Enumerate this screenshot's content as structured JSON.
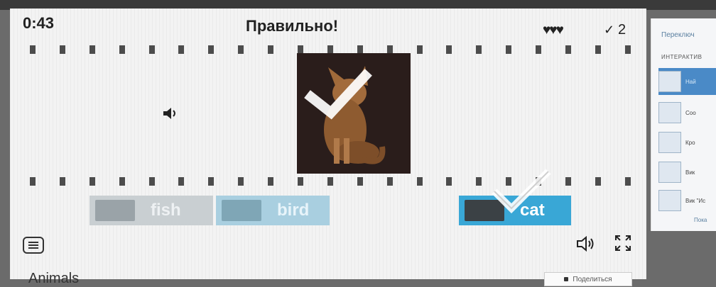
{
  "game": {
    "timer": "0:43",
    "feedback": "Правильно!",
    "lives": "♥♥♥",
    "score_check": "✓",
    "score": "2",
    "answers": [
      {
        "label": "fish",
        "state": "faded"
      },
      {
        "label": "bird",
        "state": "faded"
      },
      {
        "label": "cat",
        "state": "correct"
      }
    ],
    "title": "Animals",
    "share_label": "Поделиться"
  },
  "sidebar": {
    "title": "Переключ",
    "header": "ИНТЕРАКТИВ",
    "items": [
      {
        "label": "Най"
      },
      {
        "label": "Соо"
      },
      {
        "label": "Кро"
      },
      {
        "label": "Вик"
      },
      {
        "label": "Вик \"Ис"
      }
    ],
    "more": "Пока"
  },
  "colors": {
    "correct_answer": "#39a7d6",
    "stage_background": "#f3f3f3",
    "sidebar_active": "#4a8ac7"
  },
  "icons": [
    "sound-icon",
    "menu-icon",
    "speaker-icon",
    "fullscreen-icon",
    "checkmark-icon",
    "lock-icon"
  ]
}
